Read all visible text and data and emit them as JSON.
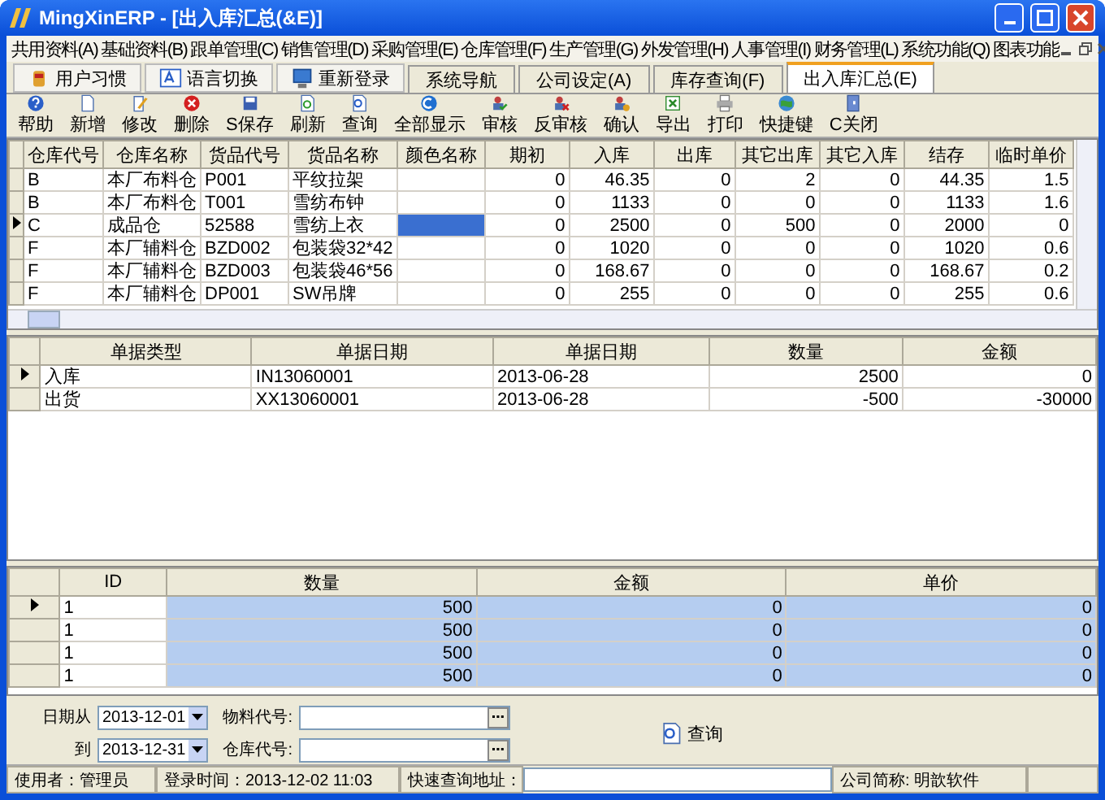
{
  "window": {
    "title": "MingXinERP - [出入库汇总(&E)]"
  },
  "menu": [
    "共用资料(A)",
    "基础资料(B)",
    "跟单管理(C)",
    "销售管理(D)",
    "采购管理(E)",
    "仓库管理(F)",
    "生产管理(G)",
    "外发管理(H)",
    "人事管理(I)",
    "财务管理(L)",
    "系统功能(Q)",
    "图表功能"
  ],
  "quick_buttons": [
    {
      "label": "用户习惯",
      "kind": "user"
    },
    {
      "label": "语言切换",
      "kind": "language"
    },
    {
      "label": "重新登录",
      "kind": "relogin"
    }
  ],
  "tabs": [
    {
      "label": "系统导航",
      "selected": false
    },
    {
      "label": "公司设定(A)",
      "selected": false
    },
    {
      "label": "库存查询(F)",
      "selected": false
    },
    {
      "label": "出入库汇总(E)",
      "selected": true
    }
  ],
  "toolbar": [
    {
      "label": "帮助",
      "kind": "help"
    },
    {
      "label": "新增",
      "kind": "new"
    },
    {
      "label": "修改",
      "kind": "edit"
    },
    {
      "label": "删除",
      "kind": "delete"
    },
    {
      "label": "S保存",
      "kind": "save"
    },
    {
      "label": "刷新",
      "kind": "refresh"
    },
    {
      "label": "查询",
      "kind": "query"
    },
    {
      "label": "全部显示",
      "kind": "showall"
    },
    {
      "label": "审核",
      "kind": "approve"
    },
    {
      "label": "反审核",
      "kind": "unapprove"
    },
    {
      "label": "确认",
      "kind": "confirm"
    },
    {
      "label": "导出",
      "kind": "export"
    },
    {
      "label": "打印",
      "kind": "print"
    },
    {
      "label": "快捷键",
      "kind": "shortcut"
    },
    {
      "label": "C关闭",
      "kind": "close"
    }
  ],
  "stock_table": {
    "columns": [
      "仓库代号",
      "仓库名称",
      "货品代号",
      "货品名称",
      "颜色名称",
      "期初",
      "入库",
      "出库",
      "其它出库",
      "其它入库",
      "结存",
      "临时单价"
    ],
    "rows": [
      {
        "current": false,
        "selected": false,
        "cells": [
          "B",
          "本厂布料仓",
          "P001",
          "平纹拉架",
          "",
          "0",
          "46.35",
          "0",
          "2",
          "0",
          "44.35",
          "1.5"
        ]
      },
      {
        "current": false,
        "selected": false,
        "cells": [
          "B",
          "本厂布料仓",
          "T001",
          "雪纺布钟",
          "",
          "0",
          "1133",
          "0",
          "0",
          "0",
          "1133",
          "1.6"
        ]
      },
      {
        "current": true,
        "selected": true,
        "cells": [
          "C",
          "成品仓",
          "52588",
          "雪纺上衣",
          "",
          "0",
          "2500",
          "0",
          "500",
          "0",
          "2000",
          "0"
        ]
      },
      {
        "current": false,
        "selected": false,
        "cells": [
          "F",
          "本厂辅料仓",
          "BZD002",
          "包装袋32*42",
          "",
          "0",
          "1020",
          "0",
          "0",
          "0",
          "1020",
          "0.6"
        ]
      },
      {
        "current": false,
        "selected": false,
        "cells": [
          "F",
          "本厂辅料仓",
          "BZD003",
          "包装袋46*56",
          "",
          "0",
          "168.67",
          "0",
          "0",
          "0",
          "168.67",
          "0.2"
        ]
      },
      {
        "current": false,
        "selected": false,
        "cells": [
          "F",
          "本厂辅料仓",
          "DP001",
          "SW吊牌",
          "",
          "0",
          "255",
          "0",
          "0",
          "0",
          "255",
          "0.6"
        ]
      }
    ]
  },
  "document_table": {
    "columns": [
      "单据类型",
      "单据日期",
      "单据日期",
      "数量",
      "金额"
    ],
    "rows": [
      {
        "current": true,
        "cells": [
          "入库",
          "IN13060001",
          "2013-06-28",
          "2500",
          "0"
        ]
      },
      {
        "current": false,
        "cells": [
          "出货",
          "XX13060001",
          "2013-06-28",
          "-500",
          "-30000"
        ]
      }
    ]
  },
  "detail_table": {
    "columns": [
      "ID",
      "数量",
      "金额",
      "单价"
    ],
    "rows": [
      {
        "current": true,
        "selected": true,
        "cells": [
          "1",
          "500",
          "0",
          "0"
        ]
      },
      {
        "current": false,
        "selected": true,
        "cells": [
          "1",
          "500",
          "0",
          "0"
        ]
      },
      {
        "current": false,
        "selected": true,
        "cells": [
          "1",
          "500",
          "0",
          "0"
        ]
      },
      {
        "current": false,
        "selected": true,
        "cells": [
          "1",
          "500",
          "0",
          "0"
        ]
      }
    ]
  },
  "filter": {
    "date_from_label": "日期从",
    "date_from": "2013-12-01",
    "date_to_label": "到",
    "date_to": "2013-12-31",
    "material_label": "物料代号:",
    "warehouse_label": "仓库代号:",
    "query_button": "查询"
  },
  "status_bar": {
    "user": "使用者：管理员",
    "login_time": "登录时间：2013-12-02 11:03",
    "quick_query_label": "快速查询地址：",
    "company": "公司简称: 明歆软件"
  }
}
